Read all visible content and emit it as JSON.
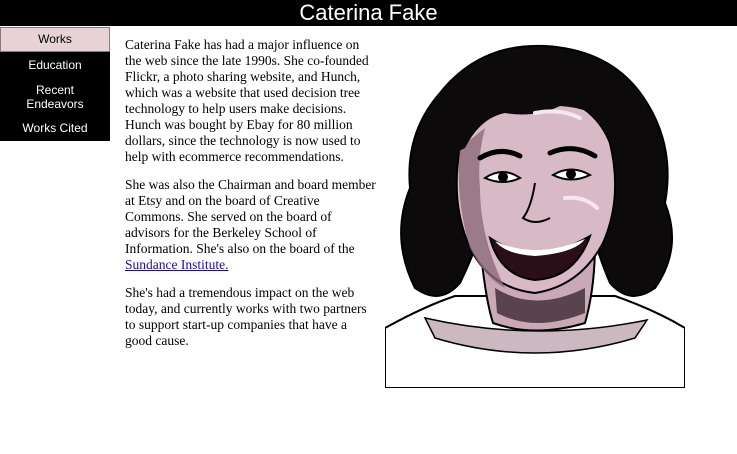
{
  "header": {
    "title": "Caterina Fake"
  },
  "nav": {
    "items": [
      {
        "label": "Works",
        "active": true
      },
      {
        "label": "Education",
        "active": false
      },
      {
        "label": "Recent Endeavors",
        "active": false
      },
      {
        "label": "Works Cited",
        "active": false
      }
    ]
  },
  "content": {
    "p1": "Caterina Fake has had a major influence on the web since the late 1990s. She co-founded Flickr, a photo sharing website, and Hunch, which was a website that used decision tree technology to help users make decisions. Hunch was bought by Ebay for 80 million dollars, since the technology is now used to help with ecommerce recommendations.",
    "p2_text": "She was also the Chairman and board member at Etsy and on the board of Creative Commons. She served on the board of advisors for the Berkeley School of Information. She's also on the board of the ",
    "p2_link": "Sundance Institute.",
    "p3": "She's had a tremendous impact on the web today, and currently works with two partners to support start-up companies that have a good cause."
  },
  "colors": {
    "header_bg": "#000000",
    "nav_bg": "#000000",
    "nav_active_bg": "#e7d2d6",
    "link": "#1a0dab"
  },
  "icons": {
    "portrait": "caterina-fake-illustration"
  }
}
